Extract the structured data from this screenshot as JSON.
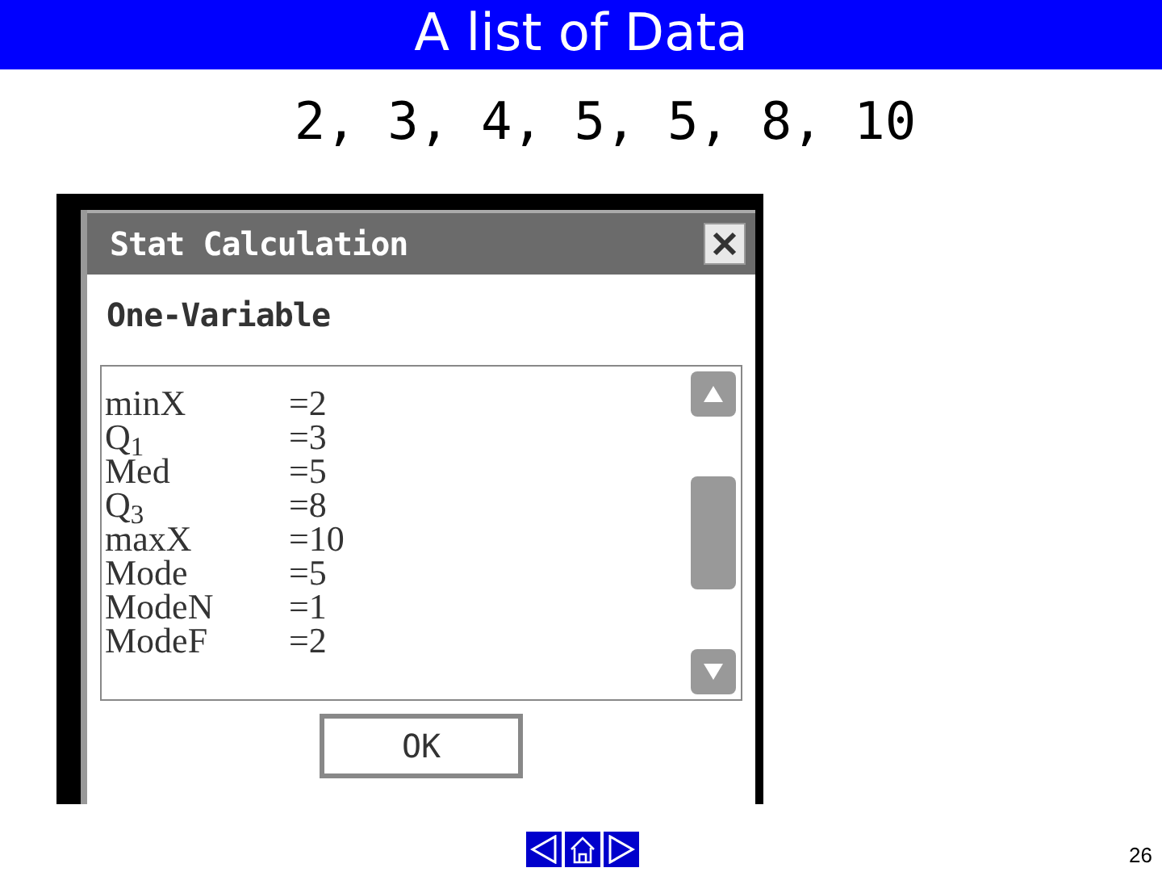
{
  "slide": {
    "title": "A list of Data",
    "subtitle": "2, 3, 4, 5, 5, 8, 10",
    "page_number": "26"
  },
  "dialog": {
    "title": "Stat Calculation",
    "heading": "One-Variable",
    "ok_button": "OK",
    "rows": [
      {
        "label": "minX",
        "value": "=2"
      },
      {
        "label": "Q$_{1}$",
        "value": "=3"
      },
      {
        "label": "Med",
        "value": "=5"
      },
      {
        "label": "Q$_{3}$",
        "value": "=8"
      },
      {
        "label": "maxX",
        "value": "=10"
      },
      {
        "label": "Mode",
        "value": "=5"
      },
      {
        "label": "ModeN",
        "value": "=1"
      },
      {
        "label": "ModeF",
        "value": "=2"
      }
    ]
  }
}
